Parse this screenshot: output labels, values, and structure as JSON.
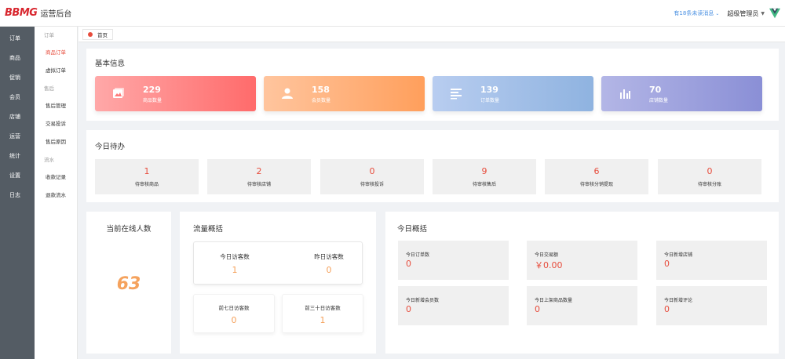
{
  "header": {
    "logo_mark": "BBMG",
    "logo_text": "运营后台",
    "message_link": "有18条未读消息",
    "user_name": "超级管理员"
  },
  "sidebar_primary": [
    "订单",
    "商品",
    "促销",
    "会员",
    "店铺",
    "运营",
    "统计",
    "设置",
    "日志"
  ],
  "sidebar_secondary": {
    "order_group": "订单",
    "order_items": [
      "商品订单",
      "虚拟订单"
    ],
    "aftersale_group": "售后",
    "aftersale_items": [
      "售后管理",
      "交易投诉",
      "售后原因"
    ],
    "flow_group": "流水",
    "flow_items": [
      "收款记录",
      "退款流水"
    ]
  },
  "tab": {
    "label": "首页"
  },
  "basic_info": {
    "title": "基本信息",
    "stats": [
      {
        "value": "229",
        "label": "商品数量",
        "icon": "image-icon"
      },
      {
        "value": "158",
        "label": "会员数量",
        "icon": "user-icon"
      },
      {
        "value": "139",
        "label": "订单数量",
        "icon": "list-icon"
      },
      {
        "value": "70",
        "label": "店铺数量",
        "icon": "bar-chart-icon"
      }
    ]
  },
  "todo": {
    "title": "今日待办",
    "items": [
      {
        "value": "1",
        "label": "待审核商品"
      },
      {
        "value": "2",
        "label": "待审核店铺"
      },
      {
        "value": "0",
        "label": "待审核投诉"
      },
      {
        "value": "9",
        "label": "待审核售后"
      },
      {
        "value": "6",
        "label": "待审核分销提现"
      },
      {
        "value": "0",
        "label": "待审核分账"
      }
    ]
  },
  "online": {
    "title": "当前在线人数",
    "value": "63"
  },
  "traffic": {
    "title": "流量概括",
    "today_label": "今日访客数",
    "today_value": "1",
    "yesterday_label": "昨日访客数",
    "yesterday_value": "0",
    "week_label": "前七日访客数",
    "week_value": "0",
    "month_label": "前三十日访客数",
    "month_value": "1"
  },
  "today_summary": {
    "title": "今日概括",
    "items": [
      {
        "label": "今日订单数",
        "value": "0"
      },
      {
        "label": "今日交易额",
        "value": "￥0.00"
      },
      {
        "label": "今日新增店铺",
        "value": "0"
      },
      {
        "label": "今日新增会员数",
        "value": "0"
      },
      {
        "label": "今日上架商品数量",
        "value": "0"
      },
      {
        "label": "今日新增评论",
        "value": "0"
      }
    ]
  },
  "colors": {
    "accent_red": "#e74c3c",
    "sidebar_bg": "#545c64",
    "online_orange": "#f5a25d"
  }
}
